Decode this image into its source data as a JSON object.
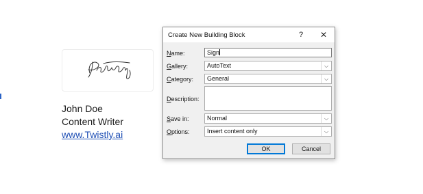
{
  "document": {
    "name": "John Doe",
    "role": "Content Writer",
    "website": "www.Twistly.ai"
  },
  "dialog": {
    "title": "Create New Building Block",
    "help_glyph": "?",
    "close_glyph": "✕",
    "fields": {
      "name": {
        "label_access": "N",
        "label_rest": "ame:",
        "value": "Sign"
      },
      "gallery": {
        "label_access": "G",
        "label_rest": "allery:",
        "value": "AutoText"
      },
      "category": {
        "label_access": "C",
        "label_rest": "ategory:",
        "value": "General"
      },
      "description": {
        "label_access": "D",
        "label_rest": "escription:",
        "value": ""
      },
      "save_in": {
        "label_pre": "S",
        "label_access": "a",
        "label_rest": "ve in:",
        "value": "Normal"
      },
      "options": {
        "label_access": "O",
        "label_rest": "ptions:",
        "value": "Insert content only"
      }
    },
    "dropdown_arrow": "⌵",
    "ok_label": "OK",
    "cancel_label": "Cancel"
  },
  "colors": {
    "link": "#1f4fb5",
    "dialog_bg": "#f0f0f0",
    "focus_accent": "#0078d7"
  }
}
